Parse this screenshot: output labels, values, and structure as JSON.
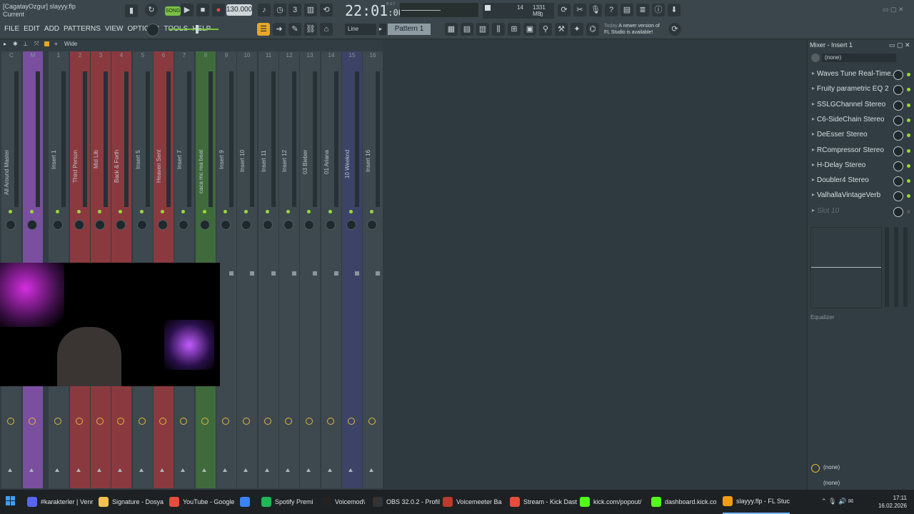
{
  "window": {
    "title_file": "[CagatayOzgur] slayyy.flp",
    "subtitle": "Current"
  },
  "transport": {
    "mode_label": "SONG",
    "tempo": "130.000",
    "time": "22:01",
    "time_small": ":00",
    "time_sig": "B:S:T",
    "cpu_value": "14",
    "memory": "1331 MB",
    "poly": "0"
  },
  "menu": [
    "FILE",
    "EDIT",
    "ADD",
    "PATTERNS",
    "VIEW",
    "OPTIONS",
    "TOOLS",
    "HELP"
  ],
  "toolbar": {
    "snap": "Line",
    "pattern": "Pattern 1",
    "news_today": "Today",
    "news_text": "A newer version of",
    "news_text2": "FL Studio is available!"
  },
  "mixer_toolbar": {
    "view": "Wide"
  },
  "mixer_tracks": [
    {
      "num": "C",
      "name": "All Around Master",
      "color": "#3d494f"
    },
    {
      "num": "M",
      "name": "",
      "color": "#7a4fa0"
    },
    {
      "num": "1",
      "name": "Insert 1",
      "color": "#3d494f"
    },
    {
      "num": "2",
      "name": "Third Person",
      "color": "#8a3a3f"
    },
    {
      "num": "3",
      "name": "Mid Lib",
      "color": "#8a3a3f"
    },
    {
      "num": "4",
      "name": "Back & Forth",
      "color": "#8a3a3f"
    },
    {
      "num": "5",
      "name": "Insert 5",
      "color": "#3d494f"
    },
    {
      "num": "6",
      "name": "Heaven Sent",
      "color": "#8a3a3f"
    },
    {
      "num": "7",
      "name": "Insert 7",
      "color": "#3d494f"
    },
    {
      "num": "8",
      "name": "caca mc rea beat",
      "color": "#3f6b3c"
    },
    {
      "num": "9",
      "name": "Insert 9",
      "color": "#3d494f"
    },
    {
      "num": "10",
      "name": "Insert 10",
      "color": "#3d494f"
    },
    {
      "num": "11",
      "name": "Insert 11",
      "color": "#3d494f"
    },
    {
      "num": "12",
      "name": "Insert 12",
      "color": "#3d494f"
    },
    {
      "num": "13",
      "name": "03 Bieber",
      "color": "#3d494f"
    },
    {
      "num": "14",
      "name": "01 Ariana",
      "color": "#3d494f"
    },
    {
      "num": "15",
      "name": "10 Weeknd",
      "color": "#3b4466"
    },
    {
      "num": "16",
      "name": "Insert 16",
      "color": "#3d494f"
    }
  ],
  "right_panel": {
    "title": "Mixer - Insert 1",
    "input": "(none)",
    "slots": [
      "Waves Tune Real-Time...",
      "Fruity parametric EQ 2",
      "SSLGChannel Stereo",
      "C6-SideChain Stereo",
      "DeEsser Stereo",
      "RCompressor Stereo",
      "H-Delay Stereo",
      "Doubler4 Stereo",
      "ValhallaVintageVerb",
      "Slot 10"
    ],
    "eq_label": "Equalizer",
    "output1": "(none)",
    "output2": "(none)"
  },
  "taskbar": {
    "items": [
      {
        "label": "#karakterler | Venr",
        "color": "#5865f2"
      },
      {
        "label": "Signature - Dosya",
        "color": "#f2c14e"
      },
      {
        "label": "YouTube - Google",
        "color": "#e74c3c"
      },
      {
        "label": "",
        "color": "#3b82f6"
      },
      {
        "label": "Spotify Premi",
        "color": "#1db954"
      },
      {
        "label": "Voicemod\\",
        "color": "#222222"
      },
      {
        "label": "OBS 32.0.2 - Profil",
        "color": "#333333"
      },
      {
        "label": "Voicemeeter Ba",
        "color": "#c0392b"
      },
      {
        "label": "Stream - Kick Dast",
        "color": "#e74c3c"
      },
      {
        "label": "kick.com/popout/",
        "color": "#53fc18"
      },
      {
        "label": "dashboard.kick.co",
        "color": "#53fc18"
      },
      {
        "label": "slayyy.flp - FL Stuc",
        "color": "#f39c12"
      }
    ],
    "time": "17:11",
    "date": "16.02.2026"
  }
}
